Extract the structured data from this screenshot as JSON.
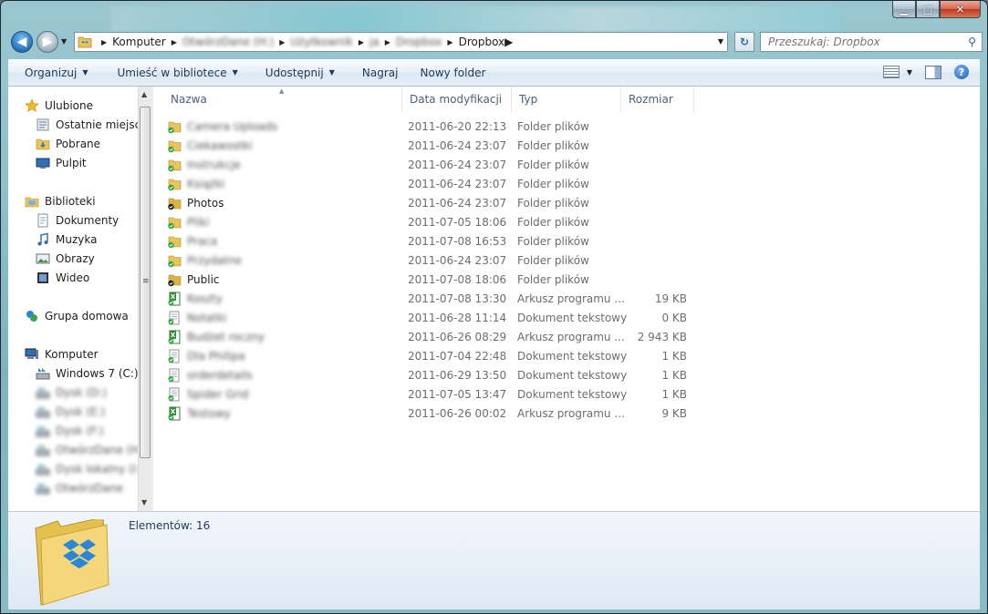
{
  "window": {
    "caption": {
      "minimize": "▁",
      "maximize": "□",
      "close": "✕"
    }
  },
  "address_bar": {
    "crumbs": [
      {
        "label": "Komputer",
        "blurred": false
      },
      {
        "label": "OtwórzDane (H:)",
        "blurred": true
      },
      {
        "label": "Użytkownik",
        "blurred": true
      },
      {
        "label": "ja",
        "blurred": true
      },
      {
        "label": "Dropbox",
        "blurred": true
      },
      {
        "label": "Dropbox",
        "blurred": false
      }
    ]
  },
  "search": {
    "placeholder": "Przeszukaj: Dropbox"
  },
  "command_bar": {
    "organize": "Organizuj",
    "include_library": "Umieść w bibliotece",
    "share": "Udostępnij",
    "burn": "Nagraj",
    "new_folder": "Nowy folder"
  },
  "sidebar": {
    "items": [
      {
        "label": "Ulubione",
        "icon": "star-icon",
        "indent": false,
        "blurred": false
      },
      {
        "label": "Ostatnie miejsca",
        "icon": "recent-places-icon",
        "indent": true,
        "blurred": false
      },
      {
        "label": "Pobrane",
        "icon": "downloads-folder-icon",
        "indent": true,
        "blurred": false
      },
      {
        "label": "Pulpit",
        "icon": "desktop-icon",
        "indent": true,
        "blurred": false
      },
      {
        "label": "Biblioteki",
        "icon": "libraries-icon",
        "indent": false,
        "blurred": false
      },
      {
        "label": "Dokumenty",
        "icon": "documents-icon",
        "indent": true,
        "blurred": false
      },
      {
        "label": "Muzyka",
        "icon": "music-icon",
        "indent": true,
        "blurred": false
      },
      {
        "label": "Obrazy",
        "icon": "pictures-icon",
        "indent": true,
        "blurred": false
      },
      {
        "label": "Wideo",
        "icon": "video-icon",
        "indent": true,
        "blurred": false
      },
      {
        "label": "Grupa domowa",
        "icon": "homegroup-icon",
        "indent": false,
        "blurred": false
      },
      {
        "label": "Komputer",
        "icon": "computer-icon",
        "indent": false,
        "blurred": false
      },
      {
        "label": "Windows 7 (C:)",
        "icon": "drive-icon",
        "indent": true,
        "blurred": false
      },
      {
        "label": "Dysk (D:)",
        "icon": "drive-icon",
        "indent": true,
        "blurred": true
      },
      {
        "label": "Dysk (E:)",
        "icon": "drive-icon",
        "indent": true,
        "blurred": true
      },
      {
        "label": "Dysk (F:)",
        "icon": "drive-icon",
        "indent": true,
        "blurred": true
      },
      {
        "label": "OtwórzDane (H:)",
        "icon": "drive-icon",
        "indent": true,
        "blurred": true
      },
      {
        "label": "Dysk lokalny (I:)",
        "icon": "drive-icon",
        "indent": true,
        "blurred": true
      },
      {
        "label": "OtwórzDane",
        "icon": "drive-icon",
        "indent": true,
        "blurred": true
      }
    ]
  },
  "columns": {
    "name": "Nazwa",
    "date": "Data modyfikacji",
    "type": "Typ",
    "size": "Rozmiar"
  },
  "files": [
    {
      "name": "Camera Uploads",
      "blurred": true,
      "date": "2011-06-20 22:13",
      "type": "Folder plików",
      "size": "",
      "kind": "folder"
    },
    {
      "name": "Ciekawostki",
      "blurred": true,
      "date": "2011-06-24 23:07",
      "type": "Folder plików",
      "size": "",
      "kind": "folder"
    },
    {
      "name": "Instrukcje",
      "blurred": true,
      "date": "2011-06-24 23:07",
      "type": "Folder plików",
      "size": "",
      "kind": "folder"
    },
    {
      "name": "Książki",
      "blurred": true,
      "date": "2011-06-24 23:07",
      "type": "Folder plików",
      "size": "",
      "kind": "folder"
    },
    {
      "name": "Photos",
      "blurred": false,
      "date": "2011-06-24 23:07",
      "type": "Folder plików",
      "size": "",
      "kind": "folder-dark"
    },
    {
      "name": "Pliki",
      "blurred": true,
      "date": "2011-07-05 18:06",
      "type": "Folder plików",
      "size": "",
      "kind": "folder"
    },
    {
      "name": "Praca",
      "blurred": true,
      "date": "2011-07-08 16:53",
      "type": "Folder plików",
      "size": "",
      "kind": "folder"
    },
    {
      "name": "Przydatne",
      "blurred": true,
      "date": "2011-06-24 23:07",
      "type": "Folder plików",
      "size": "",
      "kind": "folder"
    },
    {
      "name": "Public",
      "blurred": false,
      "date": "2011-07-08 18:06",
      "type": "Folder plików",
      "size": "",
      "kind": "folder-dark"
    },
    {
      "name": "Koszty",
      "blurred": true,
      "date": "2011-07-08 13:30",
      "type": "Arkusz programu ...",
      "size": "19 KB",
      "kind": "excel"
    },
    {
      "name": "Notatki",
      "blurred": true,
      "date": "2011-06-28 11:14",
      "type": "Dokument tekstowy",
      "size": "0 KB",
      "kind": "text"
    },
    {
      "name": "Budżet roczny",
      "blurred": true,
      "date": "2011-06-26 08:29",
      "type": "Arkusz programu ...",
      "size": "2 943 KB",
      "kind": "excel"
    },
    {
      "name": "Dla Philipa",
      "blurred": true,
      "date": "2011-07-04 22:48",
      "type": "Dokument tekstowy",
      "size": "1 KB",
      "kind": "text"
    },
    {
      "name": "orderdetails",
      "blurred": true,
      "date": "2011-06-29 13:50",
      "type": "Dokument tekstowy",
      "size": "1 KB",
      "kind": "text"
    },
    {
      "name": "Spider Grid",
      "blurred": true,
      "date": "2011-07-05 13:47",
      "type": "Dokument tekstowy",
      "size": "1 KB",
      "kind": "text"
    },
    {
      "name": "Testowy",
      "blurred": true,
      "date": "2011-06-26 00:02",
      "type": "Arkusz programu ...",
      "size": "9 KB",
      "kind": "excel"
    }
  ],
  "details": {
    "item_count": "Elementów: 16"
  },
  "colors": {
    "accent": "#1e395b",
    "folder_yellow": "#e8c45a",
    "dropbox_blue": "#2a86d8",
    "sync_green": "#2fa53a"
  }
}
